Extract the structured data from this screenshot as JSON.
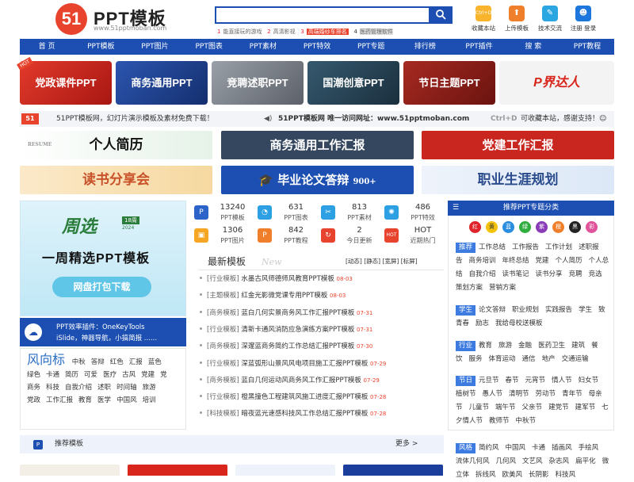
{
  "header": {
    "logo_mark": "51",
    "logo_title": "PPT模板",
    "logo_url": "www.51pptmoban.com",
    "search": {
      "value": "",
      "placeholder": ""
    },
    "hot_keys": [
      {
        "n": "1",
        "text": "能直接玩的游戏"
      },
      {
        "n": "2",
        "text": "高清影视"
      },
      {
        "n": "3",
        "text": "高端婚纱车排名"
      },
      {
        "n": "4",
        "text": "医药管理软件"
      }
    ],
    "tools": [
      {
        "label": "收藏本站",
        "icon": "ctrl-d-icon",
        "glyph": "Ctrl+D",
        "color": "#f7b42c"
      },
      {
        "label": "上传模板",
        "icon": "upload-icon",
        "glyph": "⬆",
        "color": "#f07f2c"
      },
      {
        "label": "技术交流",
        "icon": "chat-icon",
        "glyph": "✎",
        "color": "#2aa6e0"
      },
      {
        "label": "注册 登录",
        "icon": "user-icon",
        "glyph": "☻",
        "color": "#1d76db"
      }
    ]
  },
  "nav": [
    "首 页",
    "PPT模板",
    "PPT图片",
    "PPT图表",
    "PPT素材",
    "PPT特效",
    "PPT专题",
    "排行榜",
    "PPT插件",
    "搜 索",
    "PPT教程"
  ],
  "banners": [
    {
      "label": "党政课件PPT",
      "color": "#c8261f"
    },
    {
      "label": "商务通用PPT",
      "color": "#1d3f8c"
    },
    {
      "label": "竞聘述职PPT",
      "color": "#7a7f88"
    },
    {
      "label": "国潮创意PPT",
      "color": "#274457"
    },
    {
      "label": "节日主题PPT",
      "color": "#8a1f1a"
    },
    {
      "label": "P界达人",
      "color": "#f3f3f3"
    }
  ],
  "banner_hot": "HOT",
  "notice": {
    "left": "51PPT模板网，幻灯片演示模板及素材免费下载！",
    "center": "51PPT模板网 唯一访问网址：www.51pptmoban.com",
    "right_key": "Ctrl+D",
    "right": "可收藏本站，感谢支持！☺"
  },
  "ads": [
    {
      "label": "个人简历",
      "sub": "RESUME"
    },
    {
      "label": "商务通用工作汇报"
    },
    {
      "label": "党建工作汇报"
    },
    {
      "label": "读书分享会"
    },
    {
      "label": "毕业论文答辩",
      "sub": "900+"
    },
    {
      "label": "职业生涯规划"
    }
  ],
  "weekly": {
    "badge": "周选",
    "period": "18周",
    "year": "2024",
    "title": "一周精选PPT模板",
    "button": "网盘打包下载"
  },
  "plugin": {
    "title": "PPT效率插件：OneKeyTools",
    "sub": "iSlide，神器导航，小搞简报 ......"
  },
  "tags": {
    "title": "风向标",
    "items": [
      "中秋",
      "答辩",
      "红色",
      "汇报",
      "蓝色",
      "绿色",
      "卡通",
      "简历",
      "可爱",
      "医疗",
      "古风",
      "党建",
      "党",
      "商务",
      "科技",
      "自我介绍",
      "述职",
      "时间轴",
      "旅游",
      "党政",
      "工作汇报",
      "教育",
      "医学",
      "中国风",
      "培训"
    ]
  },
  "stats": [
    {
      "value": "13240",
      "label": "PPT模板",
      "icon": "ppt-icon",
      "glyph": "P",
      "color": "#2b63c9"
    },
    {
      "value": "631",
      "label": "PPT图表",
      "icon": "pie-chart-icon",
      "glyph": "◔",
      "color": "#2da0e3"
    },
    {
      "value": "813",
      "label": "PPT素材",
      "icon": "material-icon",
      "glyph": "✂",
      "color": "#2da0e3"
    },
    {
      "value": "486",
      "label": "PPT特效",
      "icon": "effect-icon",
      "glyph": "✺",
      "color": "#2da0e3"
    },
    {
      "value": "1306",
      "label": "PPT图片",
      "icon": "image-icon",
      "glyph": "▣",
      "color": "#f5a623"
    },
    {
      "value": "842",
      "label": "PPT教程",
      "icon": "tutorial-icon",
      "glyph": "P",
      "color": "#f07f2c"
    },
    {
      "value": "2",
      "label": "今日更新",
      "icon": "refresh-icon",
      "glyph": "↻",
      "color": "#e8432c"
    },
    {
      "value": "HOT",
      "label": "近期热门",
      "icon": "hot-icon",
      "glyph": "HOT",
      "color": "#e8432c"
    }
  ],
  "latest": {
    "title": "最新模板",
    "watermark": "New",
    "filters": [
      "[动态]",
      "[静态]",
      "[宽屏]",
      "[标屏]"
    ],
    "items": [
      {
        "cat": "行业模板",
        "title": "水墨古风师德师风教育PPT模板",
        "date": "08-03"
      },
      {
        "cat": "主题模板",
        "title": "红金光影微党课专用PPT模板",
        "date": "08-03"
      },
      {
        "cat": "商务模板",
        "title": "蓝白几何实景商务风工作汇报PPT模板",
        "date": "07-31"
      },
      {
        "cat": "行业模板",
        "title": "清新卡通风消防应急演练方案PPT模板",
        "date": "07-31"
      },
      {
        "cat": "商务模板",
        "title": "深邃蓝商务简约工作总结汇报PPT模板",
        "date": "07-30"
      },
      {
        "cat": "行业模板",
        "title": "深蓝弧形山景风风电项目施工汇报PPT模板",
        "date": "07-29"
      },
      {
        "cat": "商务模板",
        "title": "蓝白几何运动风商务风工作汇报PPT模板",
        "date": "07-29"
      },
      {
        "cat": "行业模板",
        "title": "橙黑撞色工程建筑风施工进度汇报PPT模板",
        "date": "07-28"
      },
      {
        "cat": "科技模板",
        "title": "暗夜蓝光速感科技风工作总结汇报PPT模板",
        "date": "07-28"
      }
    ]
  },
  "topics": {
    "title": "推荐PPT专题分类",
    "colors": [
      {
        "label": "红",
        "color": "#e0222a"
      },
      {
        "label": "黄",
        "color": "#f4c20d"
      },
      {
        "label": "蓝",
        "color": "#2a8de0"
      },
      {
        "label": "绿",
        "color": "#2fae3f"
      },
      {
        "label": "紫",
        "color": "#8a3bb8"
      },
      {
        "label": "橙",
        "color": "#f07f2c"
      },
      {
        "label": "黑",
        "color": "#222222"
      },
      {
        "label": "彩",
        "color": "#e0529a"
      }
    ],
    "groups": [
      {
        "label": "推荐",
        "items": [
          "工作总结",
          "工作报告",
          "工作计划",
          "述职报告",
          "商务培训",
          "年终总结",
          "党建",
          "个人简历",
          "个人总结",
          "自我介绍",
          "读书笔记",
          "读书分享",
          "竞聘",
          "竞选",
          "策划方案",
          "营销方案"
        ]
      },
      {
        "label": "学生",
        "items": [
          "论文答辩",
          "职业规划",
          "实践报告",
          "学生",
          "致青春",
          "励志",
          "我给母校送模板"
        ]
      },
      {
        "label": "行业",
        "items": [
          "教育",
          "旅游",
          "金融",
          "医药卫生",
          "建筑",
          "餐饮",
          "服务",
          "体育运动",
          "通信",
          "地产",
          "交通运输"
        ]
      },
      {
        "label": "节日",
        "items": [
          "元旦节",
          "春节",
          "元宵节",
          "情人节",
          "妇女节",
          "植树节",
          "愚人节",
          "清明节",
          "劳动节",
          "青年节",
          "母亲节",
          "儿童节",
          "端午节",
          "父亲节",
          "建党节",
          "建军节",
          "七夕情人节",
          "教师节",
          "中秋节"
        ]
      },
      {
        "label": "风格",
        "items": [
          "简约风",
          "中国风",
          "卡通",
          "插画风",
          "手绘风",
          "流体几何风",
          "几何风",
          "文艺风",
          "杂志风",
          "扁平化",
          "微立体",
          "拆线风",
          "欧美风",
          "长阴影",
          "科技风"
        ]
      }
    ]
  },
  "recommend": {
    "title": "推荐模板",
    "more": "更多 >"
  }
}
